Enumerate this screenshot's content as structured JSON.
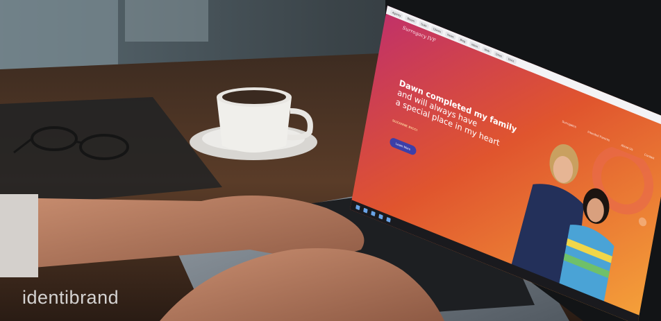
{
  "watermark": "identibrand",
  "website": {
    "logo_text": "Surrogacy IVF",
    "headline_line1": "Dawn completed my family",
    "headline_line2": "and will always have",
    "headline_line3": "a special place in my heart",
    "author": "SUZANNE RICCI",
    "cta_label": "Learn More",
    "nav": [
      "Surrogates",
      "Intended Parents",
      "About Us",
      "Contact"
    ],
    "bookmarks": [
      "Agency",
      "Bloom",
      "Suite",
      "Clients",
      "News",
      "Blog",
      "Inbox",
      "Web",
      "Drive",
      "Docs"
    ],
    "colors": {
      "gradient_start": "#c0306a",
      "gradient_mid": "#e0552e",
      "gradient_end": "#f5a23a",
      "cta": "#3c3fa8"
    }
  }
}
